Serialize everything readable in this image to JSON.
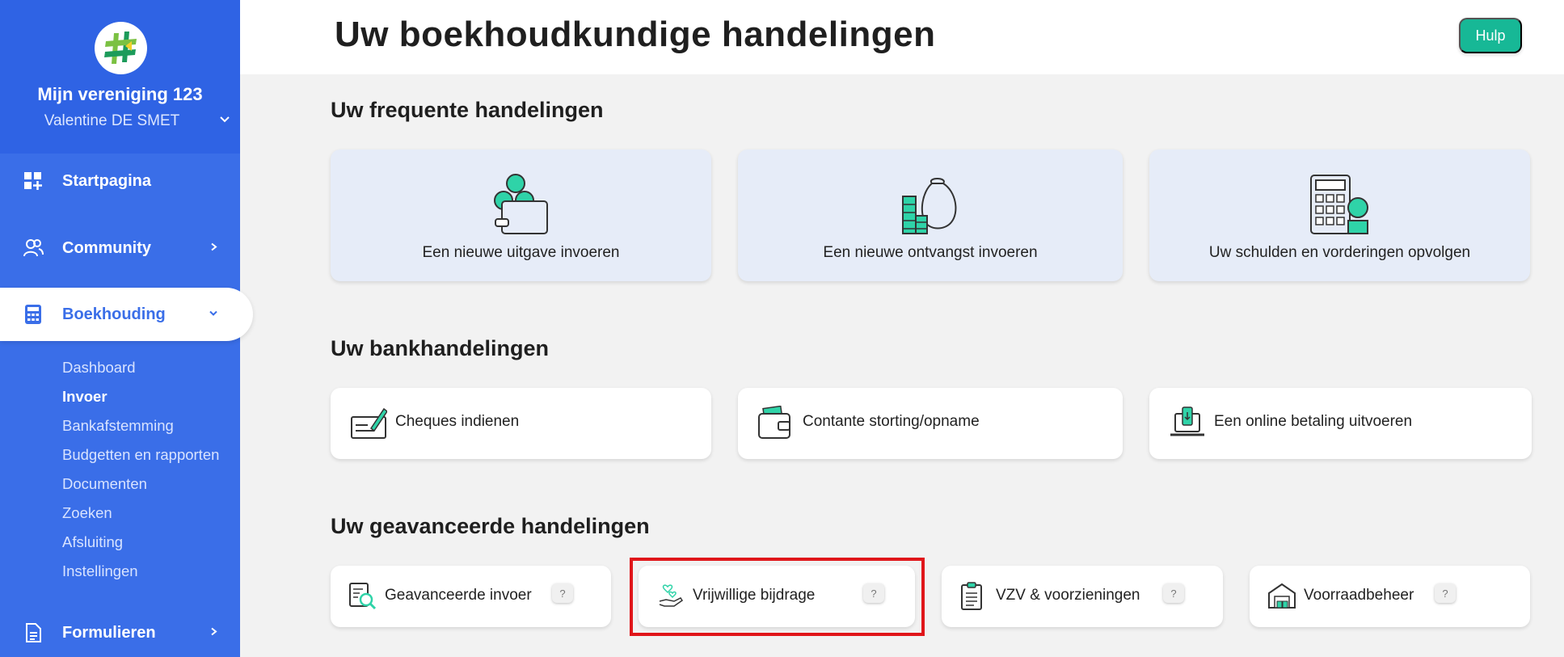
{
  "sidebar": {
    "org_name": "Mijn vereniging 123",
    "user_name": "Valentine DE SMET",
    "nav": {
      "home": "Startpagina",
      "community": "Community",
      "accounting": "Boekhouding",
      "forms": "Formulieren"
    },
    "subnav": [
      "Dashboard",
      "Invoer",
      "Bankafstemming",
      "Budgetten en rapporten",
      "Documenten",
      "Zoeken",
      "Afsluiting",
      "Instellingen"
    ],
    "current_subnav": "Invoer"
  },
  "header": {
    "title": "Uw boekhoudkundige handelingen",
    "help_label": "Hulp"
  },
  "sections": {
    "frequent": {
      "title": "Uw frequente handelingen",
      "cards": [
        "Een nieuwe uitgave invoeren",
        "Een nieuwe ontvangst invoeren",
        "Uw schulden en vorderingen opvolgen"
      ]
    },
    "bank": {
      "title": "Uw bankhandelingen",
      "cards": [
        "Cheques indienen",
        "Contante storting/opname",
        "Een online betaling uitvoeren"
      ]
    },
    "advanced": {
      "title": "Uw geavanceerde handelingen",
      "cards": [
        "Geavanceerde invoer",
        "Vrijwillige bijdrage",
        "VZV & voorzieningen",
        "Voorraadbeheer"
      ],
      "help_mark": "?"
    }
  },
  "colors": {
    "sidebar": "#3a6ee8",
    "accent_green": "#17b896",
    "highlight_red": "#e0161a"
  }
}
